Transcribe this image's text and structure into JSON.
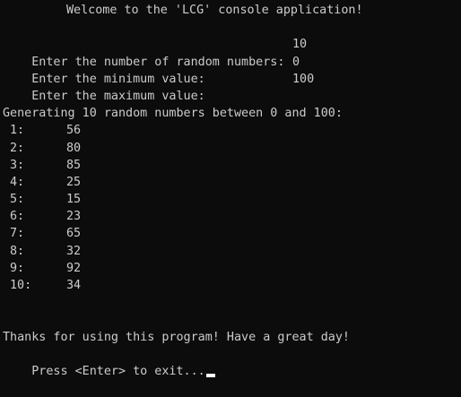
{
  "console": {
    "title_line": "Welcome to the 'LCG' console application!",
    "prompts": [
      {
        "label": "Enter the number of random numbers:",
        "value": "10"
      },
      {
        "label": "Enter the minimum value:",
        "value": "0"
      },
      {
        "label": "Enter the maximum value:",
        "value": "100"
      }
    ],
    "generating_line": "Generating 10 random numbers between 0 and 100:",
    "results": [
      {
        "index": "1:",
        "value": "56"
      },
      {
        "index": "2:",
        "value": "80"
      },
      {
        "index": "3:",
        "value": "85"
      },
      {
        "index": "4:",
        "value": "25"
      },
      {
        "index": "5:",
        "value": "15"
      },
      {
        "index": "6:",
        "value": "23"
      },
      {
        "index": "7:",
        "value": "65"
      },
      {
        "index": "8:",
        "value": "32"
      },
      {
        "index": "9:",
        "value": "92"
      },
      {
        "index": "10:",
        "value": "34"
      }
    ],
    "thanks_line": "Thanks for using this program! Have a great day!",
    "exit_line": "Press <Enter> to exit..."
  },
  "colors": {
    "background": "#0c0c0c",
    "text": "#cccccc",
    "cursor": "#ffffff"
  }
}
